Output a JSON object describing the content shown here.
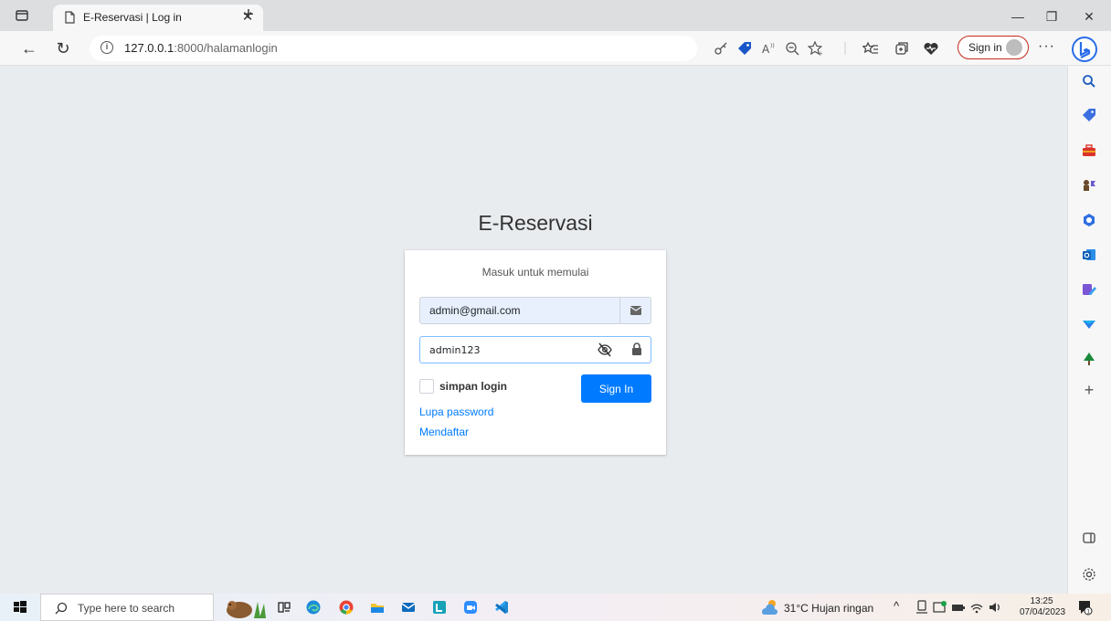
{
  "browser": {
    "tab_title": "E-Reservasi | Log in",
    "url_host": "127.0.0.1",
    "url_rest": ":8000/halamanlogin",
    "profile_label": "Sign in",
    "more_label": "···"
  },
  "login": {
    "brand": "E-Reservasi",
    "message": "Masuk untuk memulai",
    "email_value": "admin@gmail.com",
    "password_value": "admin123",
    "remember_label": "simpan login",
    "signin_label": "Sign In",
    "forgot_label": "Lupa password",
    "register_label": "Mendaftar"
  },
  "taskbar": {
    "search_placeholder": "Type here to search",
    "weather": "31°C  Hujan ringan",
    "time": "13:25",
    "date": "07/04/2023"
  },
  "colors": {
    "primary": "#007bff",
    "page_bg": "#e9ecef",
    "profile_border": "#c42b1c"
  }
}
